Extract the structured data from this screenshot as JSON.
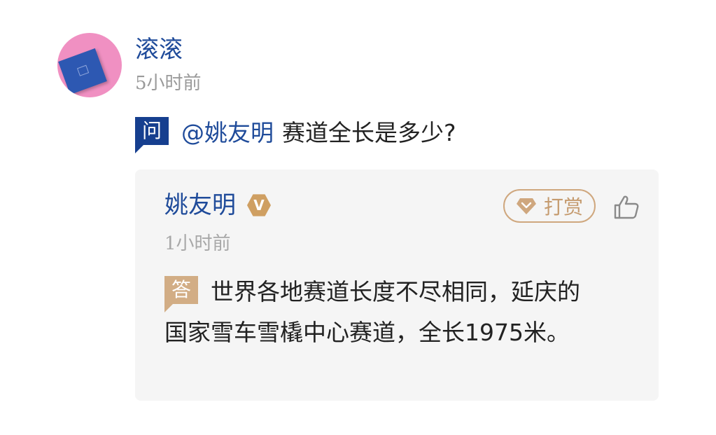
{
  "question": {
    "user_name": "滚滚",
    "time": "5小时前",
    "tag": "问",
    "mention": "@姚友明",
    "text": "赛道全长是多少?"
  },
  "answer": {
    "user_name": "姚友明",
    "verified_badge": "V",
    "reward_label": "打赏",
    "time": "1小时前",
    "tag": "答",
    "text_line_1": "世界各地赛道长度不尽相同，延庆的",
    "text_line_2": "国家雪车雪橇中心赛道，全长1975米。"
  },
  "icons": {
    "reward": "diamond-icon",
    "like": "thumbs-up-icon",
    "verified": "verified-badge-icon"
  },
  "colors": {
    "link_blue": "#1f4b9a",
    "ask_tag": "#163f8f",
    "answer_tag": "#d2ad85",
    "gold_accent": "#cfa77e",
    "card_background": "#f5f5f5"
  }
}
